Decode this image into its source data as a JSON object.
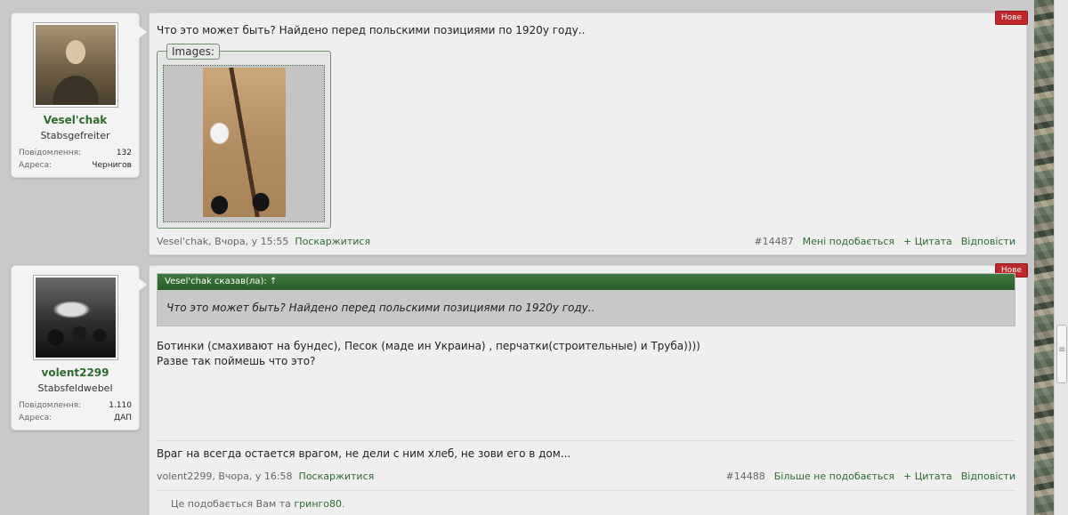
{
  "posts": [
    {
      "user": {
        "name": "Vesel'chak",
        "title": "Stabsgefreiter",
        "messages_label": "Повідомлення:",
        "messages_value": "132",
        "address_label": "Адреса:",
        "address_value": "Чернигов"
      },
      "badge": "Нове",
      "text": "Что это может быть? Найдено перед польскими позициями по 1920у году..",
      "attachment_label": "Images:",
      "meta_author": "Vesel'chak",
      "meta_date": ", Вчора, у 15:55",
      "report": "Поскаржитися",
      "post_id": "#14487",
      "like": "Мені подобається",
      "quote": "+ Цитата",
      "reply": "Відповісти"
    },
    {
      "user": {
        "name": "volent2299",
        "title": "Stabsfeldwebel",
        "messages_label": "Повідомлення:",
        "messages_value": "1.110",
        "address_label": "Адреса:",
        "address_value": "ДАП"
      },
      "badge": "Нове",
      "quote_header": "Vesel'chak сказав(ла): ↑",
      "quote_text": "Что это может быть? Найдено перед польскими позициями по 1920у году..",
      "text_line1": "Ботинки (смахивают на бундес), Песок (маде ин Украина) , перчатки(строительные) и Труба))))",
      "text_line2": "Разве так поймешь что это?",
      "signature": "Враг на всегда остается врагом, не дели с ним хлеб, не зови его в дом...",
      "meta_author": "volent2299",
      "meta_date": ", Вчора, у 16:58",
      "report": "Поскаржитися",
      "post_id": "#14488",
      "like": "Більше не подобається",
      "quote": "+ Цитата",
      "reply": "Відповісти",
      "likes_prefix": "Це подобається Вам та ",
      "likes_user": "гринго80",
      "likes_suffix": "."
    }
  ]
}
